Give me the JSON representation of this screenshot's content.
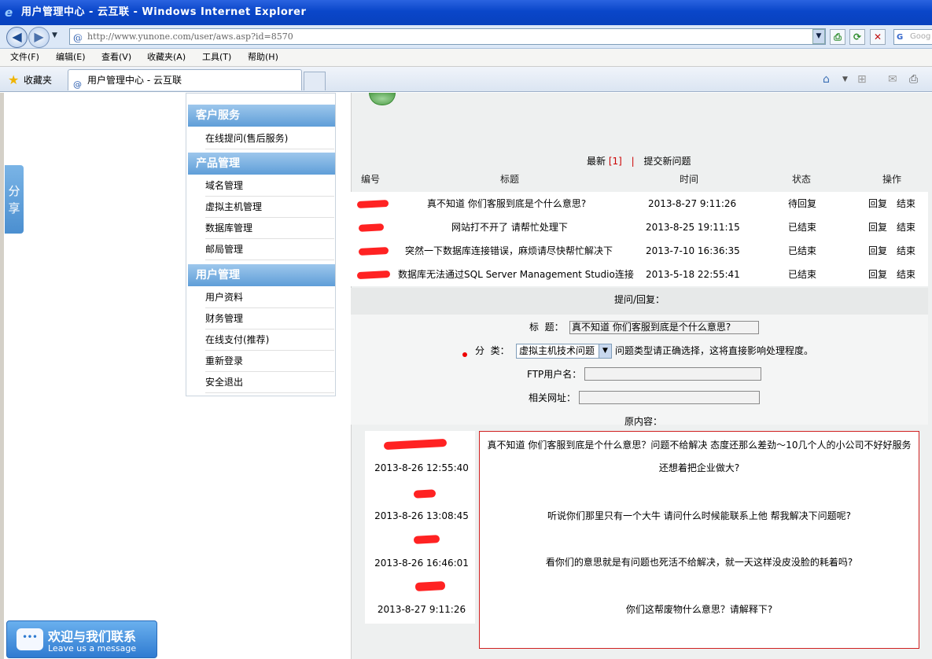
{
  "browser": {
    "title": "用户管理中心 - 云互联 - Windows Internet Explorer",
    "url": "http://www.yunone.com/user/aws.asp?id=8570",
    "search_placeholder": "Goog",
    "menu": [
      "文件(F)",
      "编辑(E)",
      "查看(V)",
      "收藏夹(A)",
      "工具(T)",
      "帮助(H)"
    ],
    "favorites_label": "收藏夹",
    "tab_title": "用户管理中心 - 云互联"
  },
  "share_label": "分享",
  "sidebar": {
    "sections": [
      {
        "title": "客户服务",
        "items": [
          "在线提问(售后服务)"
        ]
      },
      {
        "title": "产品管理",
        "items": [
          "域名管理",
          "虚拟主机管理",
          "数据库管理",
          "邮局管理"
        ]
      },
      {
        "title": "用户管理",
        "items": [
          "用户资料",
          "财务管理",
          "在线支付(推荐)",
          "重新登录",
          "安全退出"
        ]
      }
    ]
  },
  "tabs": {
    "newest_label": "最新",
    "newest_count": "[1]",
    "separator": "|",
    "submit_label": "提交新问题"
  },
  "table": {
    "headers": [
      "编号",
      "标题",
      "时间",
      "状态",
      "操作"
    ],
    "rows": [
      {
        "title": "真不知道 你们客服到底是个什么意思?",
        "time": "2013-8-27 9:11:26",
        "status": "待回复",
        "reply": "回复",
        "close": "结束"
      },
      {
        "title": "网站打不开了 请帮忙处理下",
        "time": "2013-8-25 19:11:15",
        "status": "已结束",
        "reply": "回复",
        "close": "结束"
      },
      {
        "title": "突然一下数据库连接错误，麻烦请尽快帮忙解决下",
        "time": "2013-7-10 16:36:35",
        "status": "已结束",
        "reply": "回复",
        "close": "结束"
      },
      {
        "title": "数据库无法通过SQL Server Management Studio连接",
        "time": "2013-5-18 22:55:41",
        "status": "已结束",
        "reply": "回复",
        "close": "结束"
      }
    ]
  },
  "reply_header": "提问/回复：",
  "form": {
    "title_label": "标  题：",
    "title_value": "真不知道 你们客服到底是个什么意思?",
    "category_label": "分  类：",
    "category_value": "虚拟主机技术问题",
    "category_hint": "问题类型请正确选择，这将直接影响处理程度。",
    "ftp_label": "FTP用户名：",
    "url_label": "相关网址：",
    "original_label": "原内容："
  },
  "original": {
    "times": [
      "2013-8-26 12:55:40",
      "2013-8-26 13:08:45",
      "2013-8-26 16:46:01",
      "2013-8-27 9:11:26"
    ],
    "lines": [
      "真不知道 你们客服到底是个什么意思？问题不给解决 态度还那么差劲～10几个人的小公司不好好服务",
      "还想着把企业做大?",
      "听说你们那里只有一个大牛 请问什么时候能联系上他 帮我解决下问题呢?",
      "看你们的意思就是有问题也死活不给解决，就一天这样没皮没脸的耗着吗?",
      "你们这帮废物什么意思？请解释下?"
    ]
  },
  "chat": {
    "title": "欢迎与我们联系",
    "subtitle": "Leave us a message"
  }
}
